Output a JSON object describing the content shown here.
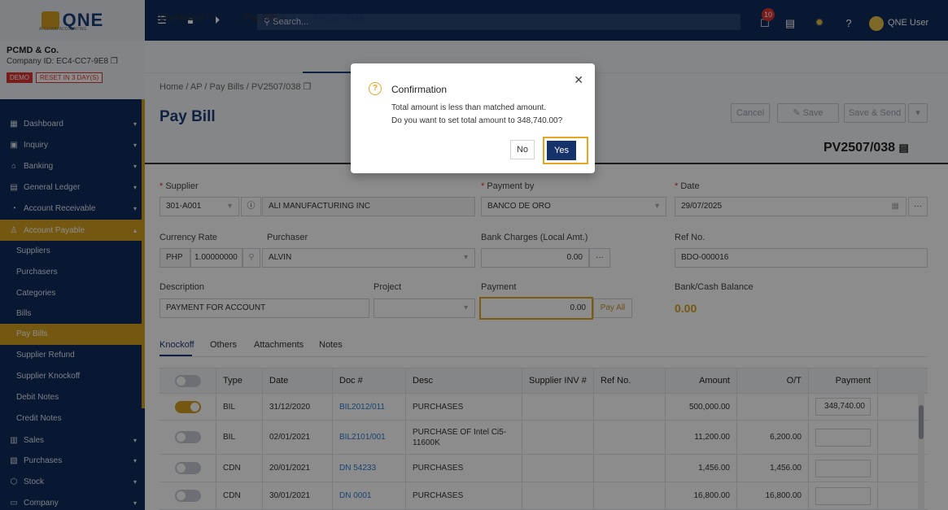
{
  "app": {
    "logo_text": "QNE",
    "logo_sub": "AI CLOUD ACCOUNTING",
    "search_placeholder": "Search...",
    "notification_count": "10",
    "user_name": "QNE User"
  },
  "company": {
    "name": "PCMD & Co.",
    "id": "Company ID: EC4-CC7-9E8",
    "demo": "DEMO",
    "reset": "RESET IN 3 DAY(S)"
  },
  "sidebar": {
    "items": [
      {
        "label": "Dashboard",
        "icon": "dashboard-icon"
      },
      {
        "label": "Inquiry",
        "icon": "inquiry-icon"
      },
      {
        "label": "Banking",
        "icon": "bank-icon"
      },
      {
        "label": "General Ledger",
        "icon": "ledger-icon"
      },
      {
        "label": "Account Receivable",
        "icon": "receivable-icon"
      },
      {
        "label": "Account Payable",
        "icon": "payable-icon"
      }
    ],
    "ap_subitems": [
      "Suppliers",
      "Purchasers",
      "Categories",
      "Bills",
      "Pay Bills",
      "Supplier Refund",
      "Supplier Knockoff",
      "Debit Notes",
      "Credit Notes"
    ],
    "bottom_items": [
      {
        "label": "Sales",
        "icon": "sales-icon"
      },
      {
        "label": "Purchases",
        "icon": "purchases-icon"
      },
      {
        "label": "Stock",
        "icon": "stock-icon"
      },
      {
        "label": "Company",
        "icon": "company-icon"
      }
    ]
  },
  "tabs": [
    "Dashboard",
    "Pay Bills",
    "PV2507/038"
  ],
  "breadcrumb": "Home  /  AP  /  Pay Bills  /  PV2507/038",
  "page_title": "Pay Bill",
  "toolbar": {
    "cancel": "Cancel",
    "save": "Save",
    "save_send": "Save & Send"
  },
  "doc_number": "PV2507/038",
  "form": {
    "supplier_label": "Supplier",
    "supplier_code": "301-A001",
    "supplier_name": "ALI MANUFACTURING INC",
    "payment_by_label": "Payment by",
    "payment_by": "BANCO DE ORO",
    "date_label": "Date",
    "date": "29/07/2025",
    "currency_rate_label": "Currency Rate",
    "currency": "PHP",
    "rate": "1.00000000",
    "purchaser_label": "Purchaser",
    "purchaser": "ALVIN",
    "bank_charges_label": "Bank Charges (Local Amt.)",
    "bank_charges": "0.00",
    "ref_no_label": "Ref No.",
    "ref_no": "BDO-000016",
    "description_label": "Description",
    "description": "PAYMENT FOR ACCOUNT",
    "project_label": "Project",
    "payment_label": "Payment",
    "payment": "0.00",
    "pay_all": "Pay All",
    "balance_label": "Bank/Cash Balance",
    "balance": "0.00"
  },
  "subtabs": [
    "Knockoff",
    "Others",
    "Attachments",
    "Notes"
  ],
  "table": {
    "headers": [
      "Type",
      "Date",
      "Doc #",
      "Desc",
      "Supplier INV #",
      "Ref No.",
      "Amount",
      "O/T",
      "Payment"
    ],
    "rows": [
      {
        "on": true,
        "type": "BIL",
        "date": "31/12/2020",
        "doc": "BIL2012/011",
        "desc": "PURCHASES",
        "amount": "500,000.00",
        "ot": "",
        "payment": "348,740.00"
      },
      {
        "on": false,
        "type": "BIL",
        "date": "02/01/2021",
        "doc": "BIL2101/001",
        "desc": "PURCHASE OF Intel Ci5-11600K",
        "amount": "11,200.00",
        "ot": "6,200.00",
        "payment": ""
      },
      {
        "on": false,
        "type": "CDN",
        "date": "20/01/2021",
        "doc": "DN 54233",
        "desc": "PURCHASES",
        "amount": "1,456.00",
        "ot": "1,456.00",
        "payment": ""
      },
      {
        "on": false,
        "type": "CDN",
        "date": "30/01/2021",
        "doc": "DN 0001",
        "desc": "PURCHASES",
        "amount": "16,800.00",
        "ot": "16,800.00",
        "payment": ""
      }
    ]
  },
  "modal": {
    "title": "Confirmation",
    "line1": "Total amount is less than matched amount.",
    "line2": "Do you want to set total amount to 348,740.00?",
    "no": "No",
    "yes": "Yes"
  }
}
